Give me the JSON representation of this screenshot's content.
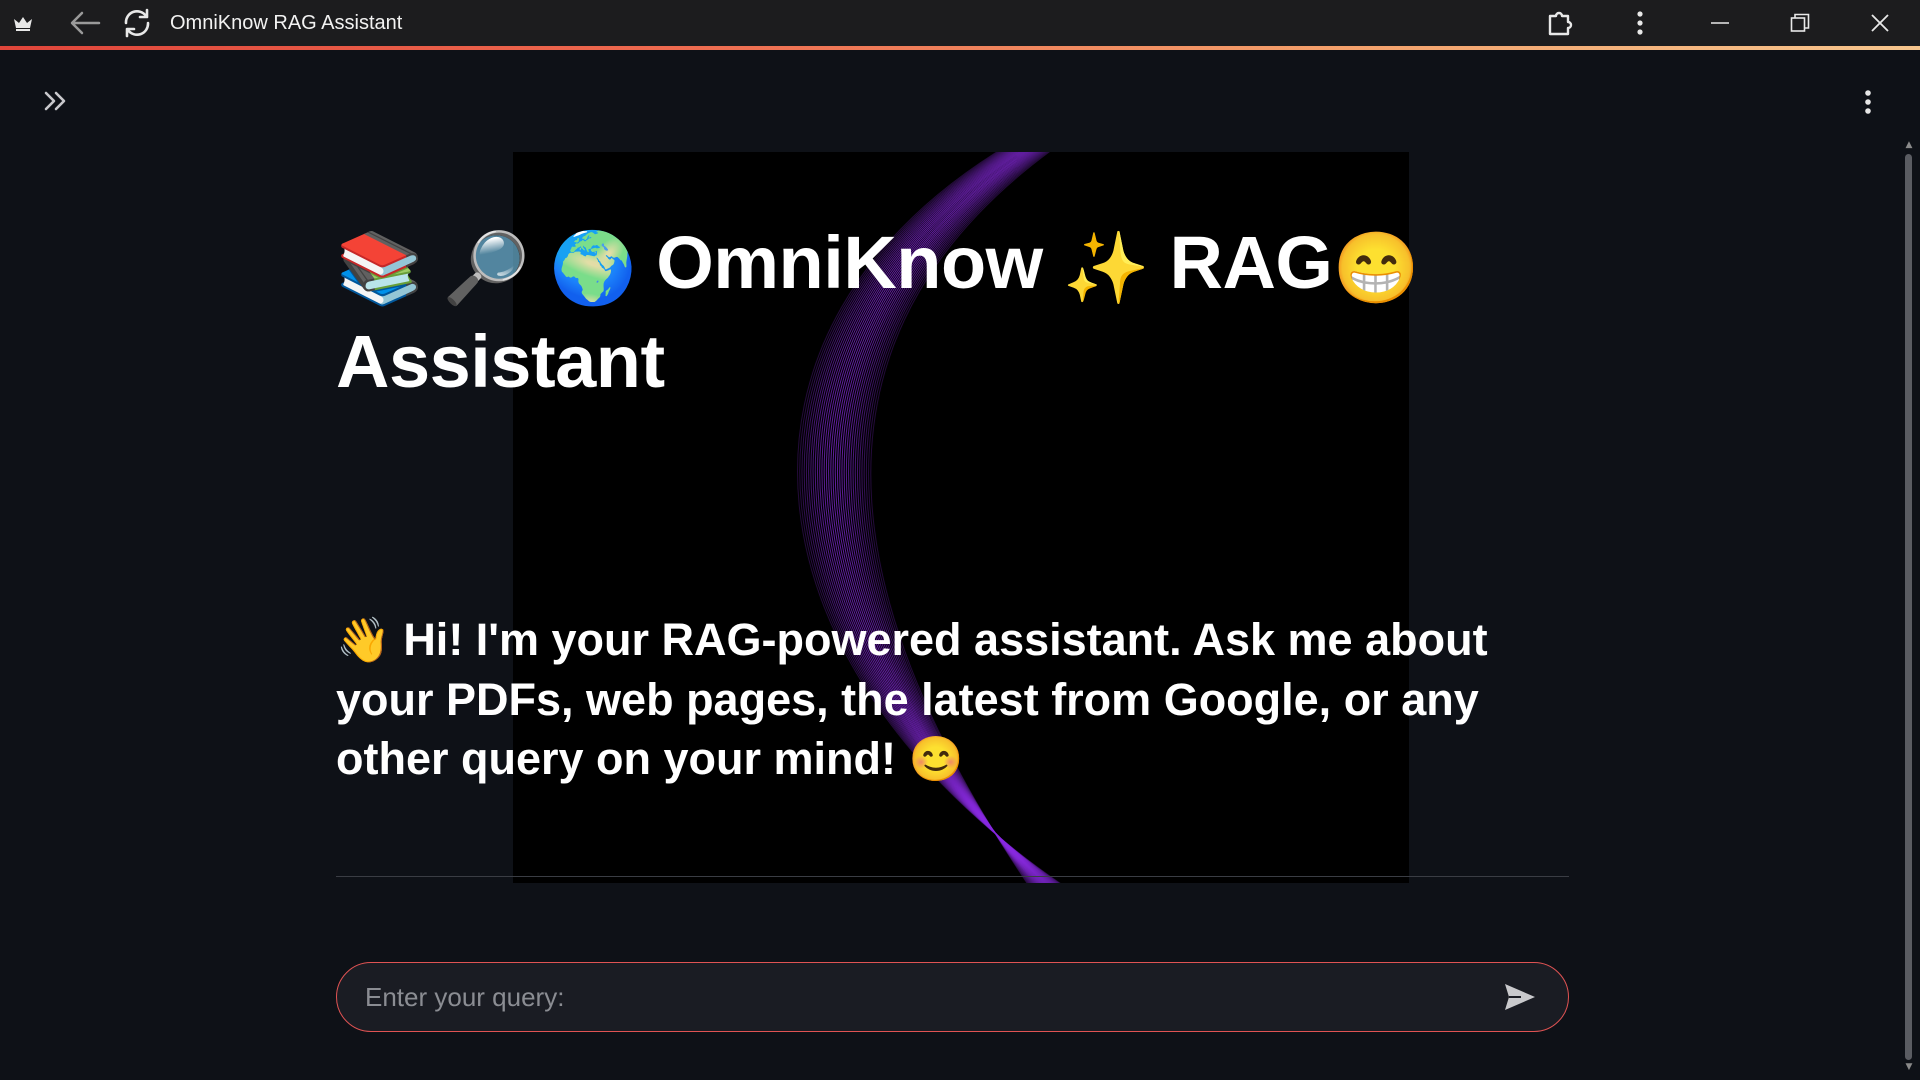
{
  "window": {
    "title": "OmniKnow RAG Assistant",
    "icons": {
      "app": "crown-icon",
      "back": "back-arrow-icon",
      "reload": "reload-icon",
      "extension": "extension-icon",
      "menu": "vertical-dots-icon",
      "minimize": "minimize-icon",
      "restore": "restore-icon",
      "close": "close-icon"
    }
  },
  "app": {
    "sidebar_toggle_icon": "double-chevron-right-icon",
    "menu_icon": "vertical-dots-icon",
    "title": {
      "emojis": [
        "📚",
        "🔎",
        "🌍"
      ],
      "word1": "OmniKnow",
      "sparkle": "✨",
      "word2": "RAG",
      "face": "😁",
      "word3": "Assistant"
    },
    "greeting": {
      "wave": "👋",
      "text": "Hi! I'm your RAG-powered assistant. Ask me about your PDFs, web pages, the latest from Google, or any other query on your mind!",
      "smile": "😊"
    },
    "query": {
      "placeholder": "Enter your query:",
      "value": "",
      "send_icon": "send-icon"
    }
  },
  "colors": {
    "background": "#0e1117",
    "input_border": "#e05353",
    "art_stroke": "#8a2be2"
  }
}
